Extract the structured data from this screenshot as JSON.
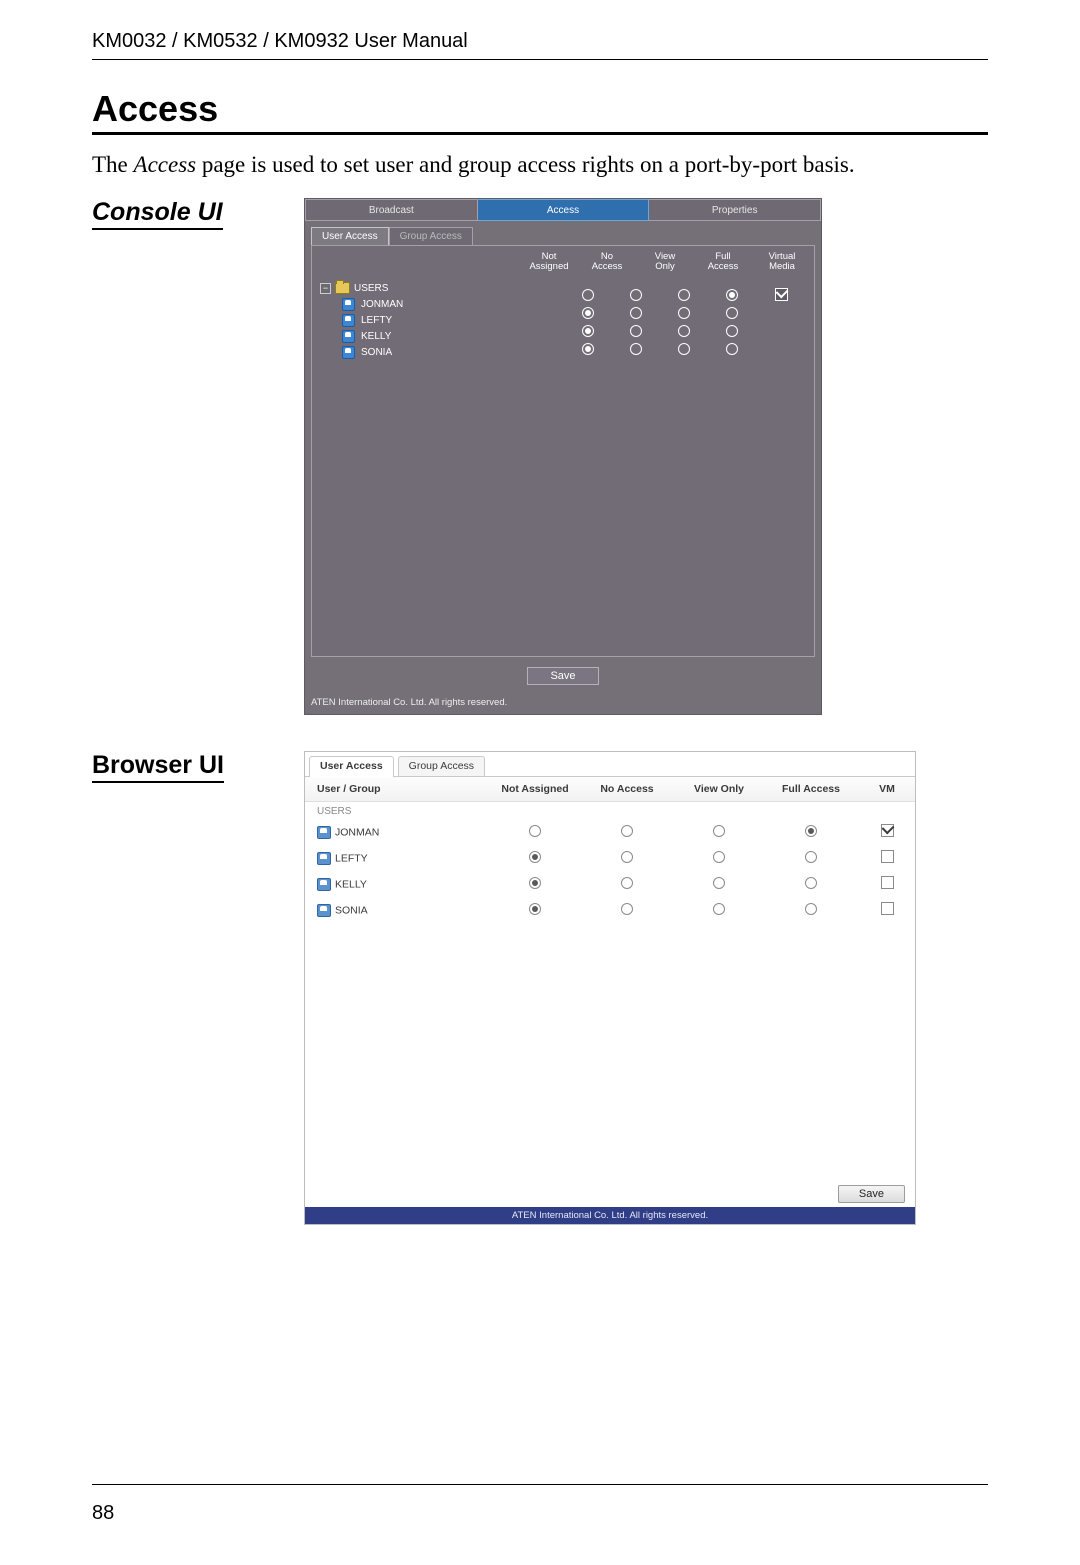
{
  "header": {
    "running": "KM0032 / KM0532 / KM0932 User Manual"
  },
  "section": {
    "title": "Access",
    "intro_pre": "The ",
    "intro_em": "Access",
    "intro_post": " page is used to set user and group access rights on a port-by-port basis."
  },
  "subsections": {
    "console": "Console UI",
    "browser": "Browser UI"
  },
  "console": {
    "tabs": [
      "Broadcast",
      "Access",
      "Properties"
    ],
    "active_tab": 1,
    "subtabs": [
      "User Access",
      "Group Access"
    ],
    "active_subtab": 0,
    "columns": {
      "not_assigned": "Not\nAssigned",
      "no_access": "No\nAccess",
      "view_only": "View\nOnly",
      "full_access": "Full\nAccess",
      "virtual_media": "Virtual\nMedia"
    },
    "tree_root": "USERS",
    "users": [
      {
        "name": "JONMAN",
        "selected": "full_access",
        "vm": true
      },
      {
        "name": "LEFTY",
        "selected": "not_assigned",
        "vm": false
      },
      {
        "name": "KELLY",
        "selected": "not_assigned",
        "vm": false
      },
      {
        "name": "SONIA",
        "selected": "not_assigned",
        "vm": false
      }
    ],
    "save": "Save",
    "copyright": "ATEN International Co. Ltd. All rights reserved."
  },
  "browser": {
    "tabs": [
      "User Access",
      "Group Access"
    ],
    "active_tab": 0,
    "columns": {
      "user_group": "User / Group",
      "not_assigned": "Not Assigned",
      "no_access": "No Access",
      "view_only": "View Only",
      "full_access": "Full Access",
      "vm": "VM"
    },
    "group_label": "USERS",
    "rows": [
      {
        "name": "JONMAN",
        "selected": "full_access",
        "vm": true
      },
      {
        "name": "LEFTY",
        "selected": "not_assigned",
        "vm": false
      },
      {
        "name": "KELLY",
        "selected": "not_assigned",
        "vm": false
      },
      {
        "name": "SONIA",
        "selected": "not_assigned",
        "vm": false
      }
    ],
    "save": "Save",
    "copyright": "ATEN International Co. Ltd. All rights reserved."
  },
  "page_number": "88"
}
